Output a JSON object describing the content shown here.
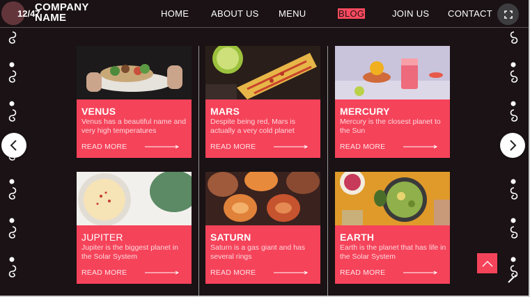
{
  "header": {
    "counter": "12/47",
    "logo_line1": "COMPANY",
    "logo_line2": "NAME",
    "nav": [
      "HOME",
      "ABOUT US",
      "MENU",
      "BLOG",
      "JOIN US",
      "CONTACT"
    ],
    "active_nav": "BLOG"
  },
  "cards": [
    {
      "title": "VENUS",
      "desc": "Venus has a beautiful name and very high temperatures",
      "read_more": "READ MORE",
      "image": "tacos"
    },
    {
      "title": "MARS",
      "desc": "Despite being red, Mars is actually a very cold planet",
      "read_more": "READ MORE",
      "image": "grilled-corn"
    },
    {
      "title": "MERCURY",
      "desc": "Mercury is the closest planet to the Sun",
      "read_more": "READ MORE",
      "image": "drink"
    },
    {
      "title": "JUPITER",
      "desc": "Jupiter is the biggest planet in the Solar System",
      "read_more": "READ MORE",
      "image": "soup"
    },
    {
      "title": "SATURN",
      "desc": "Saturn is a gas giant and has several rings",
      "read_more": "READ MORE",
      "image": "conchas"
    },
    {
      "title": "EARTH",
      "desc": "Earth is the planet that has life in the Solar System",
      "read_more": "READ MORE",
      "image": "table-spread"
    }
  ],
  "colors": {
    "accent": "#f5435a",
    "background": "#1a1214",
    "text": "#ffffff"
  },
  "icons": [
    "fullscreen-icon",
    "chevron-left-icon",
    "chevron-right-icon",
    "caret-up-icon",
    "magic-wand-icon"
  ]
}
